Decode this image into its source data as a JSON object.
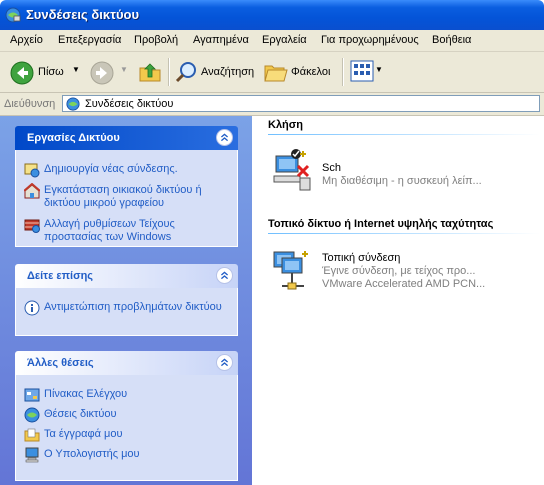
{
  "window": {
    "title": "Συνδέσεις δικτύου"
  },
  "menu": {
    "items": [
      "Αρχείο",
      "Επεξεργασία",
      "Προβολή",
      "Αγαπημένα",
      "Εργαλεία",
      "Για προχωρημένους",
      "Βοήθεια"
    ]
  },
  "toolbar": {
    "back_label": "Πίσω",
    "search_label": "Αναζήτηση",
    "folders_label": "Φάκελοι"
  },
  "address": {
    "label": "Διεύθυνση",
    "value": "Συνδέσεις δικτύου"
  },
  "sidebar": {
    "panels": [
      {
        "title": "Εργασίες Δικτύου",
        "items": [
          {
            "label": "Δημιουργία νέας σύνδεσης.",
            "icon": "new-connection-icon"
          },
          {
            "label": "Εγκατάσταση οικιακού δικτύου ή δικτύου μικρού γραφείου",
            "icon": "home-network-icon"
          },
          {
            "label": "Αλλαγή ρυθμίσεων Τείχους προστασίας των Windows",
            "icon": "firewall-icon"
          }
        ]
      },
      {
        "title": "Δείτε επίσης",
        "items": [
          {
            "label": "Αντιμετώπιση προβλημάτων δικτύου",
            "icon": "info-icon"
          }
        ]
      },
      {
        "title": "Άλλες θέσεις",
        "items": [
          {
            "label": "Πίνακας Ελέγχου",
            "icon": "control-panel-icon"
          },
          {
            "label": "Θέσεις δικτύου",
            "icon": "network-places-icon"
          },
          {
            "label": "Τα έγγραφά μου",
            "icon": "my-documents-icon"
          },
          {
            "label": "Ο Υπολογιστής μου",
            "icon": "my-computer-icon"
          }
        ]
      }
    ]
  },
  "content": {
    "groups": [
      {
        "title": "Κλήση",
        "connections": [
          {
            "name": "Sch",
            "line1": "Μη διαθέσιμη - η συσκευή λείπ...",
            "line2": ""
          }
        ]
      },
      {
        "title": "Τοπικό δίκτυο ή Internet υψηλής ταχύτητας",
        "connections": [
          {
            "name": "Τοπική σύνδεση",
            "line1": "Έγινε σύνδεση, με τείχος προ...",
            "line2": "VMware Accelerated AMD PCN..."
          }
        ]
      }
    ]
  },
  "colors": {
    "titlebar": "#0454d8",
    "sidebar_bg": "#7ba2e7",
    "link": "#215dc6",
    "panel_body": "#d6dff7"
  }
}
